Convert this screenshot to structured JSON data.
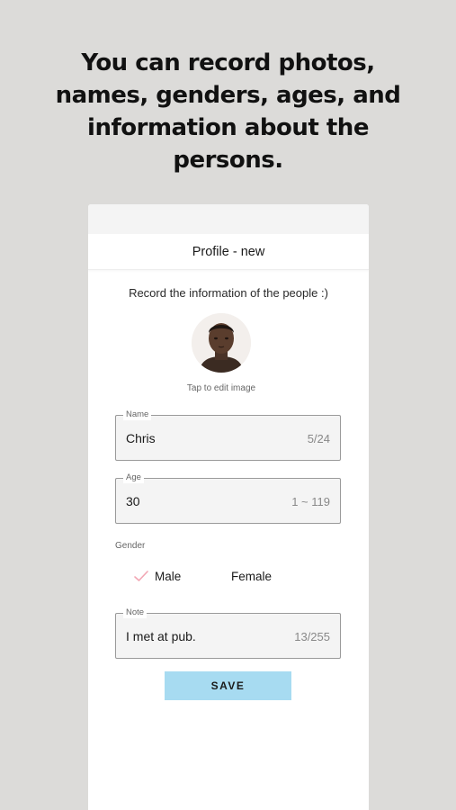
{
  "headline": [
    "You can record photos,",
    "names, genders, ages, and",
    "information about the",
    "persons."
  ],
  "nav": {
    "title": "Profile - new"
  },
  "form": {
    "subtitle": "Record the information of the people :)",
    "avatar_hint": "Tap to edit image",
    "name": {
      "label": "Name",
      "value": "Chris",
      "counter": "5/24"
    },
    "age": {
      "label": "Age",
      "value": "30",
      "range": "1 ~ 119"
    },
    "gender": {
      "label": "Gender",
      "options": [
        "Male",
        "Female"
      ],
      "selected": "Male"
    },
    "note": {
      "label": "Note",
      "value": "I met at pub.",
      "counter": "13/255"
    },
    "save_label": "SAVE"
  },
  "colors": {
    "background": "#dcdbd9",
    "save_button": "#a7dbf1",
    "check_mark": "#f2a7b4"
  }
}
